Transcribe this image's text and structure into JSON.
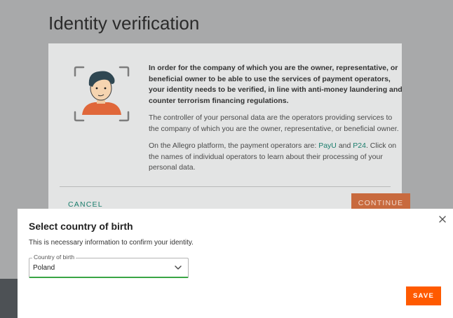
{
  "page": {
    "title": "Identity verification"
  },
  "card": {
    "intro_bold": "In order for the company of which you are the owner, representative, or beneficial owner to be able to use the services of payment operators, your identity needs to be verified, in line with anti-money laundering and counter terrorism financing regulations.",
    "controller_text": "The controller of your personal data are the operators providing services to the company of which you are the owner, representative, or beneficial owner.",
    "operators_prefix": "On the Allegro platform, the payment operators are: ",
    "operator_1": "PayU",
    "operators_and": " and ",
    "operator_2": "P24",
    "operators_suffix": ". Click on the names of individual operators to learn about their processing of your personal data.",
    "cancel_label": "CANCEL",
    "continue_label": "CONTINUE"
  },
  "modal": {
    "title": "Select country of birth",
    "subtitle": "This is necessary information to confirm your identity.",
    "select_label": "Country of birth",
    "select_value": "Poland",
    "save_label": "SAVE"
  },
  "colors": {
    "accent_orange": "#ff5a00",
    "link_teal": "#1a7d6c",
    "focus_green": "#3aa544",
    "overlay_gray": "#a8a9aa"
  },
  "icons": {
    "illustration": "identity-face-scan-illustration",
    "close": "close-icon",
    "chevron": "chevron-down-icon"
  }
}
